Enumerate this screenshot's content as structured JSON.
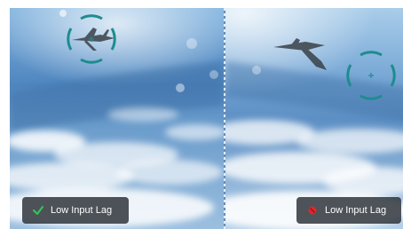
{
  "comparison": {
    "left": {
      "badge": {
        "label": "Low Input Lag",
        "status_icon": "check-icon",
        "status_color": "#34c759"
      }
    },
    "right": {
      "badge": {
        "label": "Low Input Lag",
        "status_icon": "no-icon",
        "status_color": "#e0262e"
      }
    }
  },
  "colors": {
    "reticle": "#1d8c8e",
    "badge_background": "#2c3238"
  }
}
